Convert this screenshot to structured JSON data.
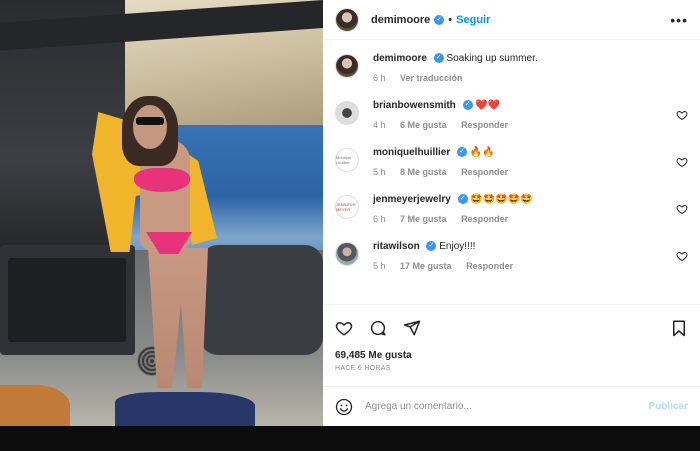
{
  "post": {
    "author": "demimoore",
    "follow_label": "Seguir",
    "more_label": "•••",
    "caption": {
      "username": "demimoore",
      "text": "Soaking up summer.",
      "time": "6 h",
      "translate_label": "Ver traducción"
    }
  },
  "comments": [
    {
      "username": "brianbowensmith",
      "text": "❤️❤️",
      "time": "4 h",
      "likes": "6 Me gusta",
      "reply": "Responder"
    },
    {
      "username": "moniquelhuillier",
      "text": "🔥🔥",
      "time": "5 h",
      "likes": "8 Me gusta",
      "reply": "Responder",
      "avatar_text": "Monique Lhuillier"
    },
    {
      "username": "jenmeyerjewelry",
      "text": "🤩🤩🤩🤩🤩",
      "time": "6 h",
      "likes": "7 Me gusta",
      "reply": "Responder",
      "avatar_text": "JENNIFER MEYER"
    },
    {
      "username": "ritawilson",
      "text": "Enjoy!!!!",
      "time": "5 h",
      "likes": "17 Me gusta",
      "reply": "Responder"
    }
  ],
  "stats": {
    "likes": "69,485 Me gusta",
    "posted": "HACE 6 HORAS"
  },
  "add_comment": {
    "placeholder": "Agrega un comentario...",
    "publish_label": "Publicar"
  },
  "icons": [
    "heart-icon",
    "comment-icon",
    "share-icon",
    "bookmark-icon",
    "emoji-icon",
    "verified-icon"
  ],
  "colors": {
    "link": "#0095f6",
    "verified": "#3897f0",
    "muted": "#8e8e8e",
    "publish_disabled": "#b3dbff"
  }
}
